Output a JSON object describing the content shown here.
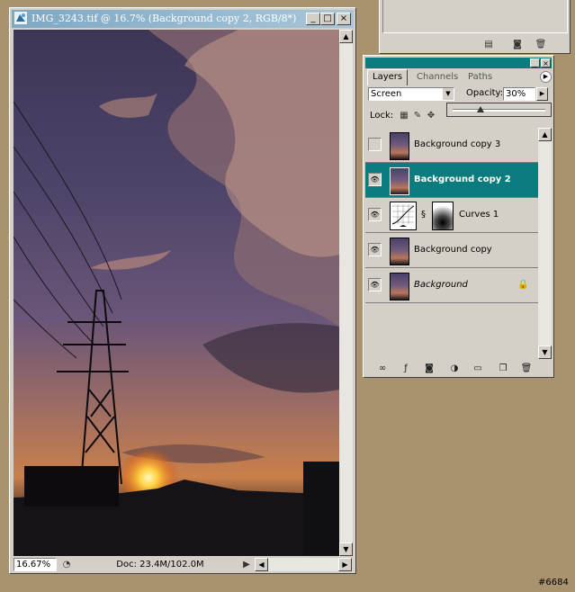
{
  "document_window": {
    "title": "IMG_3243.tif @ 16.7% (Background copy 2, RGB/8*)",
    "zoom": "16.67%",
    "doc_info": "Doc: 23.4M/102.0M",
    "buttons": {
      "minimize": "_",
      "maximize": "□",
      "close": "×"
    }
  },
  "layers_panel": {
    "tabs": [
      {
        "label": "Layers",
        "active": true
      },
      {
        "label": "Channels",
        "active": false
      },
      {
        "label": "Paths",
        "active": false
      }
    ],
    "blend_mode": "Screen",
    "opacity_label": "Opacity:",
    "opacity_value": "30%",
    "opacity_slider_fraction": 0.3,
    "lock_label": "Lock:",
    "layers": [
      {
        "name": "Background copy 3",
        "visible": false,
        "selected": false,
        "type": "image"
      },
      {
        "name": "Background copy 2",
        "visible": true,
        "selected": true,
        "type": "image"
      },
      {
        "name": "Curves 1",
        "visible": true,
        "selected": false,
        "type": "adjustment"
      },
      {
        "name": "Background copy",
        "visible": true,
        "selected": false,
        "type": "image"
      },
      {
        "name": "Background",
        "visible": true,
        "selected": false,
        "type": "image",
        "locked": true
      }
    ]
  },
  "watermark": "#6684",
  "colors": {
    "desktop": "#a9936e",
    "panel_face": "#d4d0c8",
    "selected_layer": "#0a7c7e",
    "doc_titlebar": "#7fa8c4"
  }
}
